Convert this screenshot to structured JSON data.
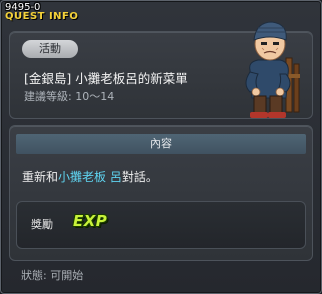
{
  "window": {
    "quest_id": "9495-0",
    "title": "QUEST INFO"
  },
  "quest": {
    "tag": "活動",
    "name": "[金銀島] 小攤老板呂的新菜單",
    "level": "建議等級: 10～14"
  },
  "content": {
    "header": "內容",
    "text_prefix": "重新和",
    "npc_name": "小攤老板 呂",
    "text_suffix": "對話。"
  },
  "reward": {
    "label": "獎勵",
    "exp": "EXP"
  },
  "status": {
    "text": "狀態:  可開始"
  },
  "colors": {
    "title": "#f4d23a",
    "npc_link": "#5fd4f0",
    "exp": "#c8f23a"
  }
}
